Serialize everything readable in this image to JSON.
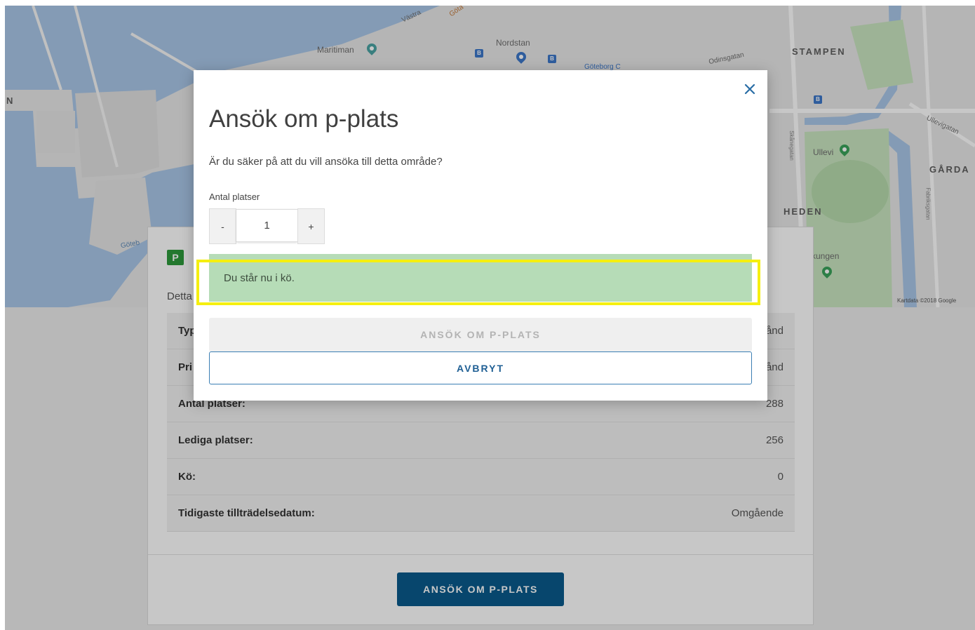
{
  "map": {
    "labels": {
      "maritiman": "Maritiman",
      "nordstan": "Nordstan",
      "goteborg_c": "Göteborg C",
      "stampen": "STAMPEN",
      "ullevi": "Ullevi",
      "garda": "GÅRDA",
      "heden": "HEDEN",
      "kungen": "kungen",
      "odinsgatan": "Odinsgatan",
      "ullevigatan": "Ullevigatan",
      "skanegatan": "Skånegatan",
      "fabriksgatan": "Fabriksgatan",
      "vastra": "Västra",
      "gota": "Göta",
      "goteb": "Göteb",
      "n_edge": "N"
    },
    "attribution": "Kartdata ©2018 Google",
    "colors": {
      "water": "#a9c7e8",
      "land": "#e6e6e6",
      "park": "#c9e6c0",
      "road": "#ffffff"
    }
  },
  "card": {
    "badge": "P",
    "intro": "Detta",
    "rows": [
      {
        "label": "Typ",
        "value": "ånd"
      },
      {
        "label": "Pri",
        "value": "ånd"
      },
      {
        "label": "Antal platser:",
        "value": "288"
      },
      {
        "label": "Lediga platser:",
        "value": "256"
      },
      {
        "label": "Kö:",
        "value": "0"
      },
      {
        "label": "Tidigaste tillträdelsedatum:",
        "value": "Omgående"
      }
    ],
    "apply_label": "ANSÖK OM P-PLATS"
  },
  "modal": {
    "title": "Ansök om p-plats",
    "question": "Är du säker på att du vill ansöka till detta område?",
    "quantity_label": "Antal platser",
    "decrement_label": "-",
    "increment_label": "+",
    "quantity_value": "1",
    "queue_message": "Du står nu i kö.",
    "apply_label": "ANSÖK OM P-PLATS",
    "cancel_label": "AVBRYT",
    "close_icon": "close-icon"
  },
  "colors": {
    "accent_blue": "#0a5a8c",
    "success_bg": "#b6dcb7",
    "highlight": "#f5ef10"
  }
}
